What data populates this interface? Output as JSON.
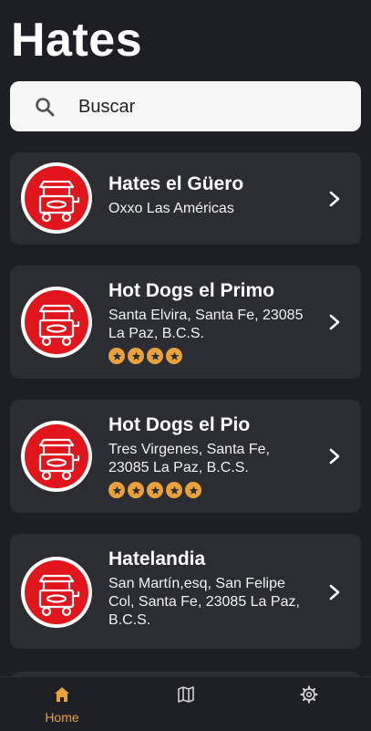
{
  "app": {
    "title": "Hates"
  },
  "search": {
    "placeholder": "Buscar"
  },
  "places": [
    {
      "name": "Hates el Güero",
      "address": "Oxxo Las Américas",
      "rating": 0
    },
    {
      "name": "Hot Dogs el Primo",
      "address": "Santa Elvira, Santa Fe, 23085 La Paz, B.C.S.",
      "rating": 4
    },
    {
      "name": "Hot Dogs el Pio",
      "address": "Tres Virgenes, Santa Fe, 23085 La Paz, B.C.S.",
      "rating": 5
    },
    {
      "name": "Hatelandia",
      "address": "San Martín,esq, San Felipe Col, Santa Fe, 23085 La Paz, B.C.S.",
      "rating": 0
    }
  ],
  "nav": {
    "items": [
      {
        "label": "Home",
        "icon": "home-icon",
        "active": true
      },
      {
        "label": "",
        "icon": "map-icon",
        "active": false
      },
      {
        "label": "",
        "icon": "settings-icon",
        "active": false
      }
    ]
  },
  "colors": {
    "accent": "#e9a13b",
    "brand_red": "#e0161c",
    "card": "#2b2d33",
    "background": "#1e1f24"
  }
}
